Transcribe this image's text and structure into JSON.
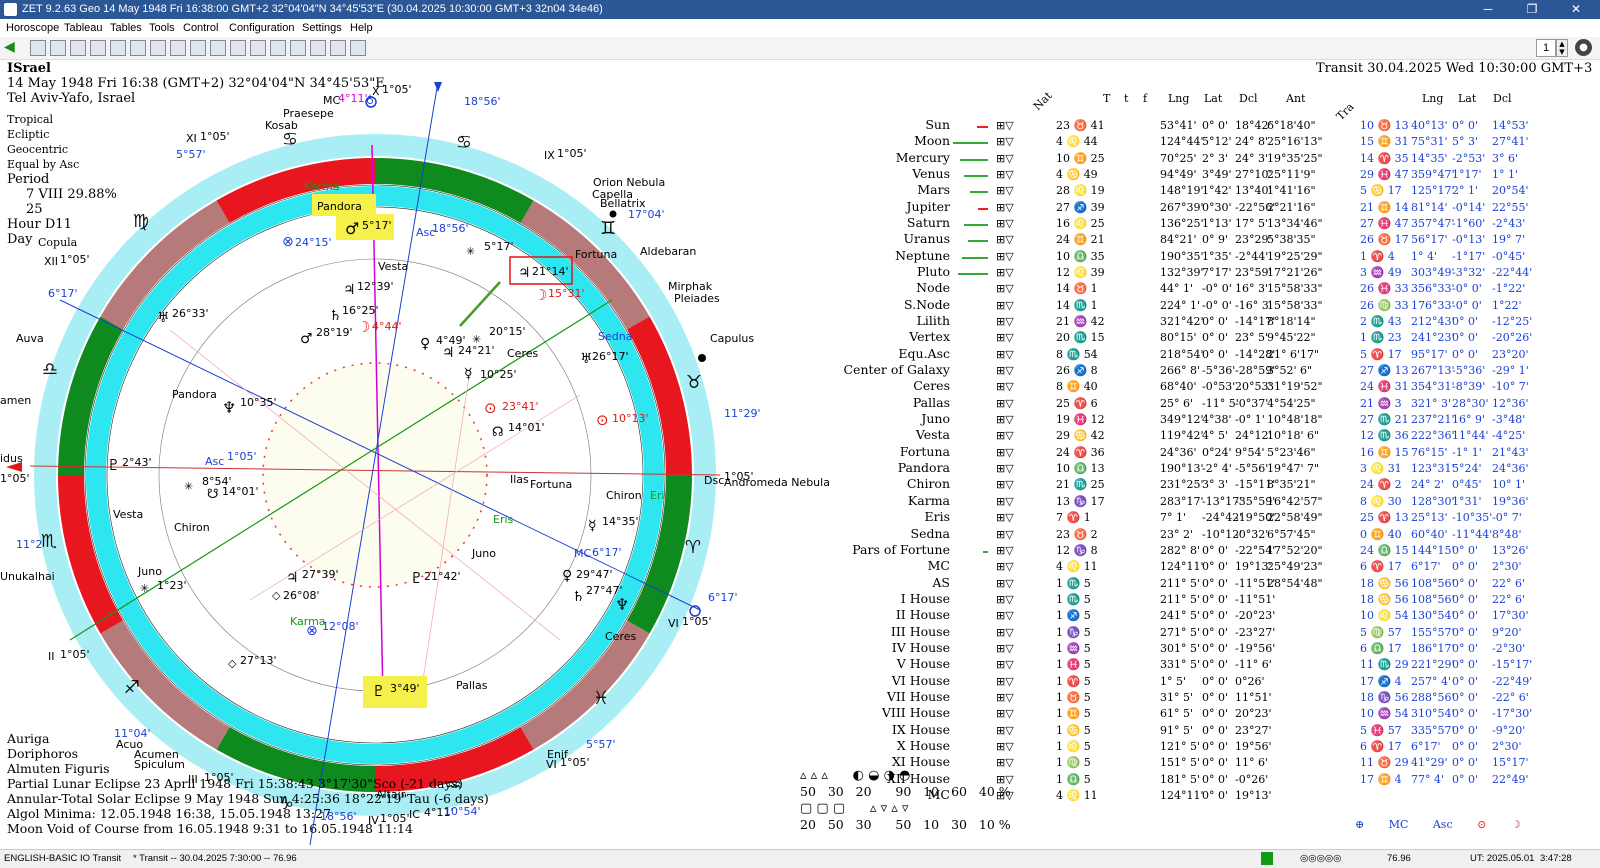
{
  "window": {
    "title": "ZET 9.2.63 Geo    14 May 1948  Fri  16:38:00 GMT+2 32°04'04\"N  34°45'53\"E    (30.04.2025  10:30:00 GMT+3 32n04 34e46)"
  },
  "menu": [
    "Horoscope",
    "Tableau",
    "Tables",
    "Tools",
    "Control",
    "Configuration",
    "Settings",
    "Help"
  ],
  "toolbar": {
    "number": "1"
  },
  "chart_info": {
    "name": "ISrael",
    "datetime": "14 May 1948  Fri  16:38 (GMT+2) 32°04'04\"N  34°45'53\"E",
    "place": "Tel Aviv-Yafo, Israel",
    "settings": [
      "Tropical",
      "Ecliptic",
      "Geocentric",
      "Equal by Asc"
    ],
    "period_label": "Period",
    "period_value": "7 VIII  29.88%",
    "period_value2": "25",
    "hour_label": "Hour D11",
    "day_label": "Day",
    "day_value": "Copula"
  },
  "transit_header": "Transit 30.04.2025  Wed 10:30:00 GMT+3",
  "table_headers": {
    "nat": "Nat",
    "T": "T",
    "t": "t",
    "f": "f",
    "lng": "Lng",
    "lat": "Lat",
    "dcl": "Dcl",
    "ant": "Ant",
    "tra": "Tra",
    "lng2": "Lng",
    "lat2": "Lat",
    "dcl2": "Dcl"
  },
  "rows": [
    {
      "name": "Sun",
      "nat": "23 ♉ 41",
      "lng": "53°41'",
      "lat": "0° 0'",
      "dcl": "18°42'",
      "ant": "6°18'40\"",
      "tra": "10 ♉ 13",
      "tlng": "40°13'",
      "tlat": "0° 0'",
      "tdcl": "14°53'"
    },
    {
      "name": "Moon",
      "nat": "4 ♌ 44",
      "lng": "124°44'",
      "lat": "5°12'",
      "dcl": "24° 8'",
      "ant": "25°16'13\"",
      "tra": "15 ♊ 31",
      "tlng": "75°31'",
      "tlat": "5° 3'",
      "tdcl": "27°41'"
    },
    {
      "name": "Mercury",
      "nat": "10 ♊ 25",
      "lng": "70°25'",
      "lat": "2° 3'",
      "dcl": "24° 3'",
      "ant": "19°35'25\"",
      "tra": "14 ♈ 35",
      "tlng": "14°35'",
      "tlat": "-2°53'",
      "tdcl": "3° 6'"
    },
    {
      "name": "Venus",
      "nat": "4 ♋ 49",
      "lng": "94°49'",
      "lat": "3°49'",
      "dcl": "27°10'",
      "ant": "25°11'9\"",
      "tra": "29 ♓ 47",
      "tlng": "359°47'",
      "tlat": "1°17'",
      "tdcl": "1° 1'"
    },
    {
      "name": "Mars",
      "nat": "28 ♌ 19",
      "lng": "148°19'",
      "lat": "1°42'",
      "dcl": "13°40'",
      "ant": "1°41'16\"",
      "tra": "5 ♋ 17",
      "tlng": "125°17'",
      "tlat": "2° 1'",
      "tdcl": "20°54'"
    },
    {
      "name": "Jupiter",
      "nat": "27 ♐ 39",
      "lng": "267°39'",
      "lat": "0°30'",
      "dcl": "-22°56'",
      "ant": "2°21'16\"",
      "tra": "21 ♊ 14",
      "tlng": "81°14'",
      "tlat": "-0°14'",
      "tdcl": "22°55'"
    },
    {
      "name": "Saturn",
      "nat": "16 ♌ 25",
      "lng": "136°25'",
      "lat": "1°13'",
      "dcl": "17° 5'",
      "ant": "13°34'46\"",
      "tra": "27 ♓ 47",
      "tlng": "357°47'",
      "tlat": "-1°60'",
      "tdcl": "-2°43'"
    },
    {
      "name": "Uranus",
      "nat": "24 ♊ 21",
      "lng": "84°21'",
      "lat": "0° 9'",
      "dcl": "23°29'",
      "ant": "5°38'35\"",
      "tra": "26 ♉ 17",
      "tlng": "56°17'",
      "tlat": "-0°13'",
      "tdcl": "19° 7'"
    },
    {
      "name": "Neptune",
      "nat": "10 ♎ 35",
      "lng": "190°35'",
      "lat": "1°35'",
      "dcl": "-2°44'",
      "ant": "19°25'29\"",
      "tra": "1 ♈ 4",
      "tlng": "1° 4'",
      "tlat": "-1°17'",
      "tdcl": "-0°45'"
    },
    {
      "name": "Pluto",
      "nat": "12 ♌ 39",
      "lng": "132°39'",
      "lat": "7°17'",
      "dcl": "23°59'",
      "ant": "17°21'26\"",
      "tra": "3 ♒ 49",
      "tlng": "303°49'",
      "tlat": "-3°32'",
      "tdcl": "-22°44'"
    },
    {
      "name": "Node",
      "nat": "14 ♉ 1",
      "lng": "44° 1'",
      "lat": "-0° 0'",
      "dcl": "16° 3'",
      "ant": "15°58'33\"",
      "tra": "26 ♓ 33",
      "tlng": "356°33'",
      "tlat": "-0° 0'",
      "tdcl": "-1°22'"
    },
    {
      "name": "S.Node",
      "nat": "14 ♏ 1",
      "lng": "224° 1'",
      "lat": "-0° 0'",
      "dcl": "-16° 3'",
      "ant": "15°58'33\"",
      "tra": "26 ♍ 33",
      "tlng": "176°33'",
      "tlat": "-0° 0'",
      "tdcl": "1°22'"
    },
    {
      "name": "Lilith",
      "nat": "21 ♒ 42",
      "lng": "321°42'",
      "lat": "0° 0'",
      "dcl": "-14°17'",
      "ant": "8°18'14\"",
      "tra": "2 ♏ 43",
      "tlng": "212°43'",
      "tlat": "0° 0'",
      "tdcl": "-12°25'"
    },
    {
      "name": "Vertex",
      "nat": "20 ♏ 15",
      "lng": "80°15'",
      "lat": "0° 0'",
      "dcl": "23° 5'",
      "ant": "9°45'22\"",
      "tra": "1 ♏ 23",
      "tlng": "241°23'",
      "tlat": "0° 0'",
      "tdcl": "-20°26'"
    },
    {
      "name": "Equ.Asc",
      "nat": "8 ♏ 54",
      "lng": "218°54'",
      "lat": "0° 0'",
      "dcl": "-14°28'",
      "ant": "21° 6'17\"",
      "tra": "5 ♈ 17",
      "tlng": "95°17'",
      "tlat": "0° 0'",
      "tdcl": "23°20'"
    },
    {
      "name": "Center of Galaxy",
      "nat": "26 ♐ 8",
      "lng": "266° 8'",
      "lat": "-5°36'",
      "dcl": "-28°59'",
      "ant": "3°52' 6\"",
      "tra": "27 ♐ 13",
      "tlng": "267°13'",
      "tlat": "-5°36'",
      "tdcl": "-29° 1'"
    },
    {
      "name": "Ceres",
      "nat": "8 ♊ 40",
      "lng": "68°40'",
      "lat": "-0°53'",
      "dcl": "20°53'",
      "ant": "31°19'52\"",
      "tra": "24 ♓ 31",
      "tlng": "354°31'",
      "tlat": "-8°39'",
      "tdcl": "-10° 7'"
    },
    {
      "name": "Pallas",
      "nat": "25 ♈ 6",
      "lng": "25° 6'",
      "lat": "-11° 5'",
      "dcl": "-0°37'",
      "ant": "4°54'25\"",
      "tra": "21 ♒ 3",
      "tlng": "321° 3'",
      "tlat": "28°30'",
      "tdcl": "12°36'"
    },
    {
      "name": "Juno",
      "nat": "19 ♓ 12",
      "lng": "349°12'",
      "lat": "4°38'",
      "dcl": "-0° 1'",
      "ant": "10°48'18\"",
      "tra": "27 ♏ 21",
      "tlng": "237°21'",
      "tlat": "16° 9'",
      "tdcl": "-3°48'"
    },
    {
      "name": "Vesta",
      "nat": "29 ♋ 42",
      "lng": "119°42'",
      "lat": "4° 5'",
      "dcl": "24°12'",
      "ant": "10°18' 6\"",
      "tra": "12 ♏ 36",
      "tlng": "222°36'",
      "tlat": "11°44'",
      "tdcl": "-4°25'"
    },
    {
      "name": "Fortuna",
      "nat": "24 ♈ 36",
      "lng": "24°36'",
      "lat": "0°24'",
      "dcl": "9°54'",
      "ant": "5°23'46\"",
      "tra": "16 ♊ 15",
      "tlng": "76°15'",
      "tlat": "-1° 1'",
      "tdcl": "21°43'"
    },
    {
      "name": "Pandora",
      "nat": "10 ♎ 13",
      "lng": "190°13'",
      "lat": "-2° 4'",
      "dcl": "-5°56'",
      "ant": "19°47' 7\"",
      "tra": "3 ♌ 31",
      "tlng": "123°31'",
      "tlat": "5°24'",
      "tdcl": "24°36'"
    },
    {
      "name": "Chiron",
      "nat": "21 ♏ 25",
      "lng": "231°25'",
      "lat": "3° 3'",
      "dcl": "-15°11'",
      "ant": "8°35'21\"",
      "tra": "24 ♈ 2",
      "tlng": "24° 2'",
      "tlat": "0°45'",
      "tdcl": "10° 1'"
    },
    {
      "name": "Karma",
      "nat": "13 ♑ 17",
      "lng": "283°17'",
      "lat": "-13°17'",
      "dcl": "-35°59'",
      "ant": "16°42'57\"",
      "tra": "8 ♌ 30",
      "tlng": "128°30'",
      "tlat": "1°31'",
      "tdcl": "19°36'"
    },
    {
      "name": "Eris",
      "nat": "7 ♈ 1",
      "lng": "7° 1'",
      "lat": "-24°42'",
      "dcl": "-19°50'",
      "ant": "22°58'49\"",
      "tra": "25 ♈ 13",
      "tlng": "25°13'",
      "tlat": "-10°35'",
      "tdcl": "-0° 7'"
    },
    {
      "name": "Sedna",
      "nat": "23 ♉ 2",
      "lng": "23° 2'",
      "lat": "-10°12'",
      "dcl": "-0°32'",
      "ant": "6°57'45\"",
      "tra": "0 ♊ 40",
      "tlng": "60°40'",
      "tlat": "-11°44'",
      "tdcl": "8°48'"
    },
    {
      "name": "Pars of Fortune",
      "nat": "12 ♑ 8",
      "lng": "282° 8'",
      "lat": "0° 0'",
      "dcl": "-22°54'",
      "ant": "17°52'20\"",
      "tra": "24 ♎ 15",
      "tlng": "144°15'",
      "tlat": "0° 0'",
      "tdcl": "13°26'"
    },
    {
      "name": "MC",
      "nat": "4 ♌ 11",
      "lng": "124°11'",
      "lat": "0° 0'",
      "dcl": "19°13'",
      "ant": "25°49'23\"",
      "tra": "6 ♈ 17",
      "tlng": "6°17'",
      "tlat": "0° 0'",
      "tdcl": "2°30'"
    },
    {
      "name": "AS",
      "nat": "1 ♏ 5",
      "lng": "211° 5'",
      "lat": "0° 0'",
      "dcl": "-11°51'",
      "ant": "28°54'48\"",
      "tra": "18 ♋ 56",
      "tlng": "108°56'",
      "tlat": "0° 0'",
      "tdcl": "22° 6'"
    },
    {
      "name": "I House",
      "nat": "1 ♏ 5",
      "lng": "211° 5'",
      "lat": "0° 0'",
      "dcl": "-11°51'",
      "ant": "",
      "tra": "18 ♋ 56",
      "tlng": "108°56'",
      "tlat": "0° 0'",
      "tdcl": "22° 6'"
    },
    {
      "name": "II House",
      "nat": "1 ♐ 5",
      "lng": "241° 5'",
      "lat": "0° 0'",
      "dcl": "-20°23'",
      "ant": "",
      "tra": "10 ♌ 54",
      "tlng": "130°54'",
      "tlat": "0° 0'",
      "tdcl": "17°30'"
    },
    {
      "name": "III House",
      "nat": "1 ♑ 5",
      "lng": "271° 5'",
      "lat": "0° 0'",
      "dcl": "-23°27'",
      "ant": "",
      "tra": "5 ♍ 57",
      "tlng": "155°57'",
      "tlat": "0° 0'",
      "tdcl": "9°20'"
    },
    {
      "name": "IV House",
      "nat": "1 ♒ 5",
      "lng": "301° 5'",
      "lat": "0° 0'",
      "dcl": "-19°56'",
      "ant": "",
      "tra": "6 ♎ 17",
      "tlng": "186°17'",
      "tlat": "0° 0'",
      "tdcl": "-2°30'"
    },
    {
      "name": "V House",
      "nat": "1 ♓ 5",
      "lng": "331° 5'",
      "lat": "0° 0'",
      "dcl": "-11° 6'",
      "ant": "",
      "tra": "11 ♏ 29",
      "tlng": "221°29'",
      "tlat": "0° 0'",
      "tdcl": "-15°17'"
    },
    {
      "name": "VI House",
      "nat": "1 ♈ 5",
      "lng": "1° 5'",
      "lat": "0° 0'",
      "dcl": "0°26'",
      "ant": "",
      "tra": "17 ♐ 4",
      "tlng": "257° 4'",
      "tlat": "0° 0'",
      "tdcl": "-22°49'"
    },
    {
      "name": "VII House",
      "nat": "1 ♉ 5",
      "lng": "31° 5'",
      "lat": "0° 0'",
      "dcl": "11°51'",
      "ant": "",
      "tra": "18 ♑ 56",
      "tlng": "288°56'",
      "tlat": "0° 0'",
      "tdcl": "-22° 6'"
    },
    {
      "name": "VIII House",
      "nat": "1 ♊ 5",
      "lng": "61° 5'",
      "lat": "0° 0'",
      "dcl": "20°23'",
      "ant": "",
      "tra": "10 ♒ 54",
      "tlng": "310°54'",
      "tlat": "0° 0'",
      "tdcl": "-17°30'"
    },
    {
      "name": "IX House",
      "nat": "1 ♋ 5",
      "lng": "91° 5'",
      "lat": "0° 0'",
      "dcl": "23°27'",
      "ant": "",
      "tra": "5 ♓ 57",
      "tlng": "335°57'",
      "tlat": "0° 0'",
      "tdcl": "-9°20'"
    },
    {
      "name": "X House",
      "nat": "1 ♌ 5",
      "lng": "121° 5'",
      "lat": "0° 0'",
      "dcl": "19°56'",
      "ant": "",
      "tra": "6 ♈ 17",
      "tlng": "6°17'",
      "tlat": "0° 0'",
      "tdcl": "2°30'"
    },
    {
      "name": "XI House",
      "nat": "1 ♍ 5",
      "lng": "151° 5'",
      "lat": "0° 0'",
      "dcl": "11° 6'",
      "ant": "",
      "tra": "11 ♉ 29",
      "tlng": "41°29'",
      "tlat": "0° 0'",
      "tdcl": "15°17'"
    },
    {
      "name": "XII House",
      "nat": "1 ♎ 5",
      "lng": "181° 5'",
      "lat": "0° 0'",
      "dcl": "-0°26'",
      "ant": "",
      "tra": "17 ♊ 4",
      "tlng": "77° 4'",
      "tlat": "0° 0'",
      "tdcl": "22°49'"
    },
    {
      "name": "MC",
      "nat": "4 ♌ 11",
      "lng": "124°11'",
      "lat": "0° 0'",
      "dcl": "19°13'",
      "ant": "",
      "tra": "",
      "tlng": "",
      "tlat": "",
      "tdcl": ""
    }
  ],
  "bottom_left": {
    "stars": [
      "Auriga",
      "Doriphoros",
      "Almuten Figuris"
    ],
    "events": [
      "Partial Lunar Eclipse 23 April 1948 Fri 15:38:43 3°17'30\"Sco (-21 days)",
      "Annular-Total Solar Eclipse 9 May 1948 Sun  4:25:36 18°22'19\"Tau (-6 days)",
      "Algol Minima: 12.05.1948 16:38,  15.05.1948 13:27",
      "Moon Void of Course from 16.05.1948  9:31 to 16.05.1948 11:14"
    ]
  },
  "stats": {
    "row1a": [
      "50",
      "30",
      "20"
    ],
    "row1b": [
      "90",
      "10",
      "60",
      "40 %"
    ],
    "row2a": [
      "20",
      "50",
      "30"
    ],
    "row2b": [
      "50",
      "10",
      "30",
      "10 %"
    ]
  },
  "status": {
    "left": "ENGLISH-BASIC IO Transit",
    "mid": "* Transit -- 30.04.2025  7:30:00 -- 76.96",
    "value": "76.96",
    "ut": "UT: 2025.05.01",
    "time": "3:47:28"
  },
  "colors": {
    "titlebar": "#2b5797",
    "cyan_ring": "#2ee6f0",
    "red": "#e8161e",
    "green": "#0e8a1e",
    "rose": "#b77a7a",
    "lightcyan": "#a9eef4",
    "blue_text": "#1a3fd6"
  }
}
